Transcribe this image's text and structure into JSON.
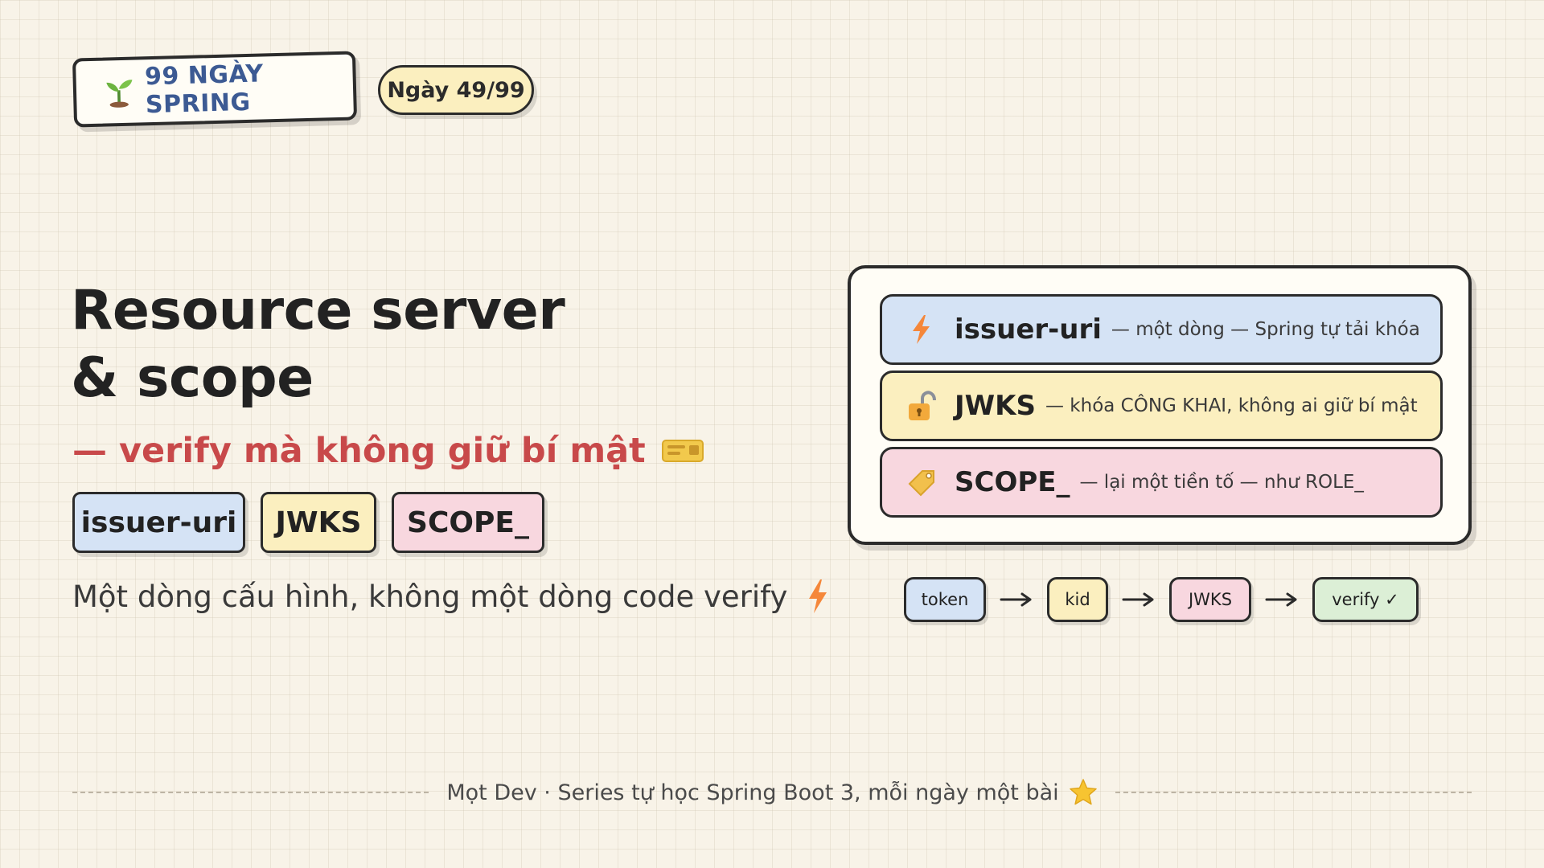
{
  "header": {
    "series_label": "99 NGÀY SPRING",
    "day_label": "Ngày 49/99",
    "series_icon": "sprout-icon"
  },
  "hero": {
    "title_line1": "Resource server",
    "title_line2": "& scope",
    "subtitle": "— verify mà không giữ bí mật",
    "subtitle_icon": "ticket-icon",
    "chips": [
      "issuer-uri",
      "JWKS",
      "SCOPE_"
    ],
    "tagline": "Một dòng cấu hình, không một dòng code verify",
    "tagline_icon": "lightning-icon"
  },
  "card": {
    "rows": [
      {
        "icon": "lightning-icon",
        "term": "issuer-uri",
        "desc": "— một dòng — Spring tự tải khóa",
        "color": "#d5e3f5"
      },
      {
        "icon": "unlocked-padlock-icon",
        "term": "JWKS",
        "desc": "— khóa CÔNG KHAI, không ai giữ bí mật",
        "color": "#fbefbf"
      },
      {
        "icon": "tag-icon",
        "term": "SCOPE_",
        "desc": "— lại một tiền tố — như ROLE_",
        "color": "#f8d7df"
      }
    ]
  },
  "flow": {
    "steps": [
      "token",
      "kid",
      "JWKS",
      "verify ✓"
    ]
  },
  "footer": {
    "text": "Mọt Dev · Series tự học Spring Boot 3, mỗi ngày một bài",
    "icon": "star-icon"
  },
  "colors": {
    "background": "#f8f3e8",
    "series_text": "#3c5a93",
    "subtitle": "#c8494a",
    "blue": "#d5e3f5",
    "yellow": "#fbefbf",
    "pink": "#f8d7df",
    "green": "#dcefd6"
  }
}
